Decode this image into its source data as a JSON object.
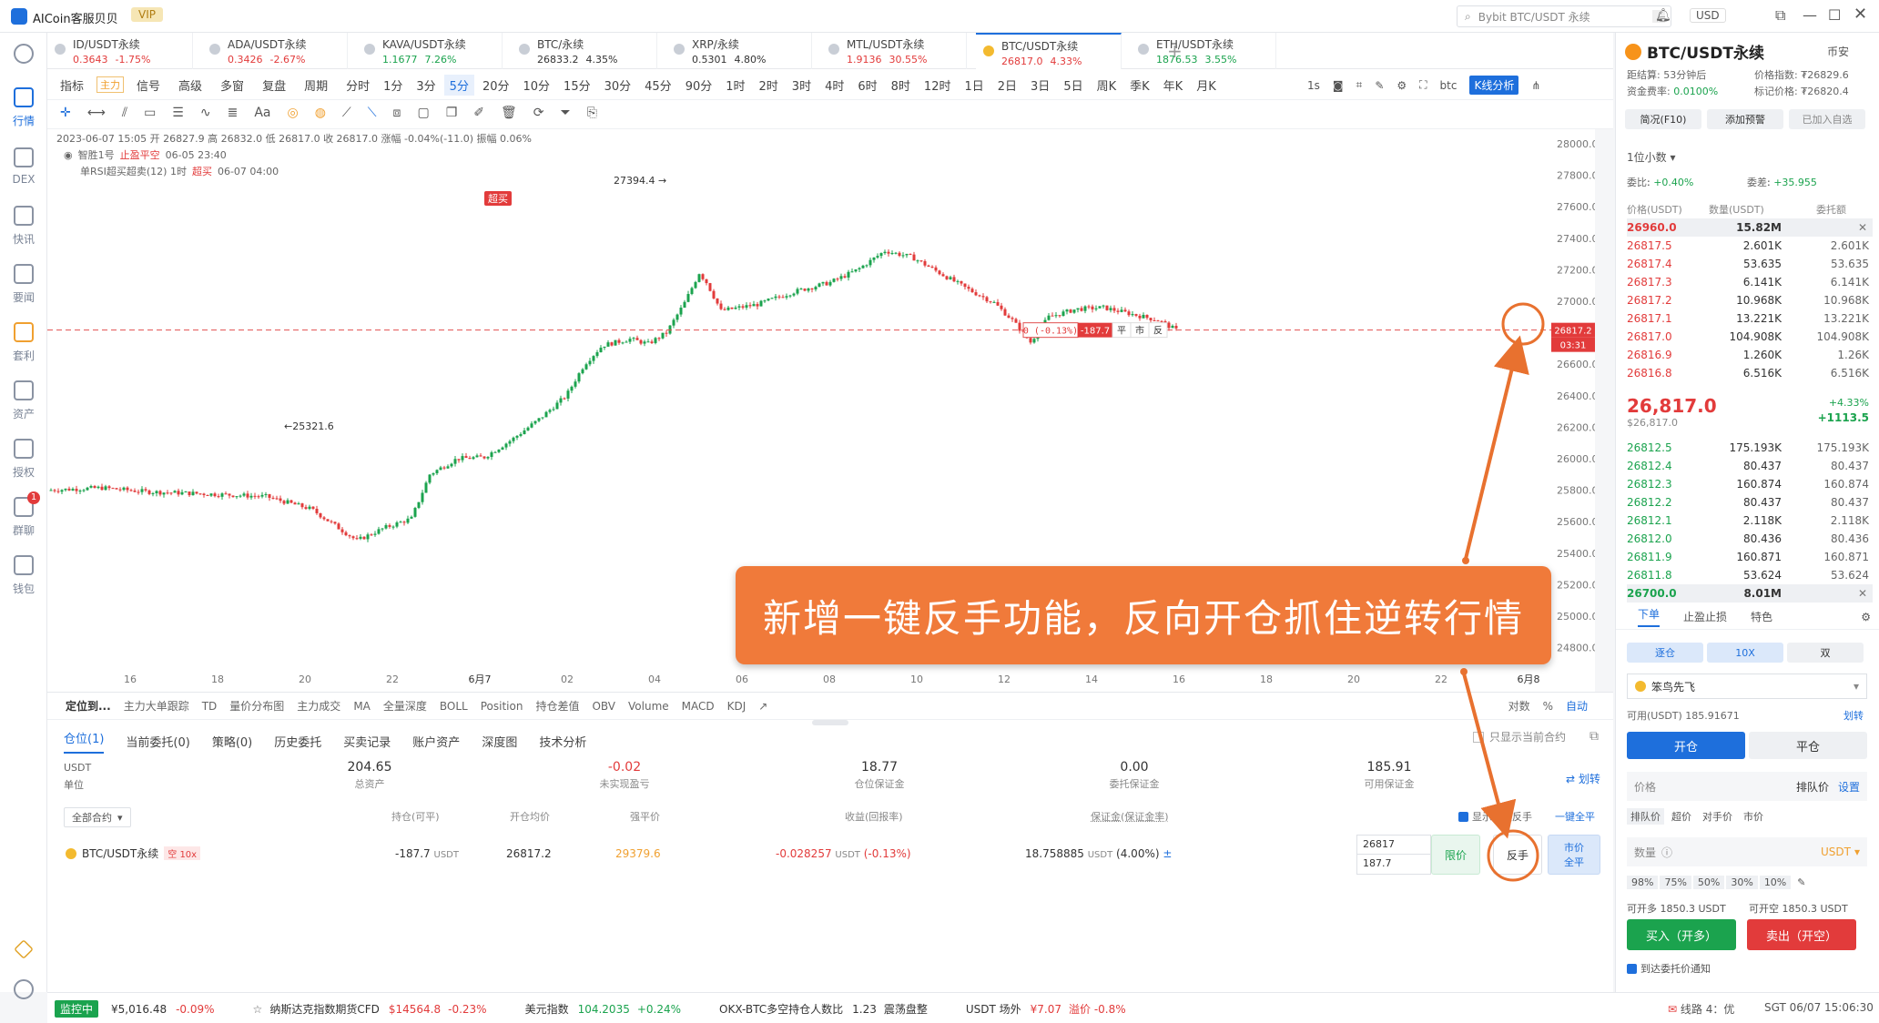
{
  "app": {
    "name": "AICoin客服贝贝",
    "vip": "VIP",
    "search_placeholder": "Bybit BTC/USDT 永续",
    "search_shortcut": "/",
    "currency": "USD"
  },
  "rail": [
    {
      "label": "",
      "icon": "globe-icon"
    },
    {
      "label": "行情",
      "icon": "market-icon"
    },
    {
      "label": "DEX",
      "icon": "dex-icon"
    },
    {
      "label": "快讯",
      "icon": "news-icon"
    },
    {
      "label": "要闻",
      "icon": "headline-icon"
    },
    {
      "label": "套利",
      "icon": "arbitrage-icon"
    },
    {
      "label": "资产",
      "icon": "wallet-icon"
    },
    {
      "label": "授权",
      "icon": "key-icon"
    },
    {
      "label": "群聊",
      "icon": "chat-icon",
      "badge": "1"
    },
    {
      "label": "钱包",
      "icon": "purse-icon"
    }
  ],
  "tabs": [
    {
      "name": "ID/USDT永续",
      "price": "0.3643",
      "change": "-1.75%",
      "dir": "dn"
    },
    {
      "name": "ADA/USDT永续",
      "price": "0.3426",
      "change": "-2.67%",
      "dir": "dn"
    },
    {
      "name": "KAVA/USDT永续",
      "price": "1.1677",
      "change": "7.26%",
      "dir": "up"
    },
    {
      "name": "BTC/永续",
      "price": "26833.2",
      "change": "4.35%",
      "dir": "plain"
    },
    {
      "name": "XRP/永续",
      "price": "0.5301",
      "change": "4.80%",
      "dir": "plain"
    },
    {
      "name": "MTL/USDT永续",
      "price": "1.9136",
      "change": "30.55%",
      "dir": "dn"
    },
    {
      "name": "BTC/USDT永续",
      "price": "26817.0",
      "change": "4.33%",
      "dir": "dn"
    },
    {
      "name": "ETH/USDT永续",
      "price": "1876.53",
      "change": "3.55%",
      "dir": "up"
    }
  ],
  "toolbar1": {
    "items": [
      "指标",
      "主力",
      "信号",
      "高级",
      "多窗",
      "复盘",
      "周期",
      "分时",
      "1分",
      "3分",
      "5分",
      "20分",
      "10分",
      "15分",
      "30分",
      "45分",
      "90分",
      "1时",
      "2时",
      "3时",
      "4时",
      "6时",
      "8时",
      "12时",
      "1日",
      "2日",
      "3日",
      "5日",
      "周K",
      "季K",
      "年K",
      "月K"
    ],
    "right": [
      "1s",
      "btc",
      "K线分析"
    ]
  },
  "ohlc": "2023-06-07 15:05  开 26827.9  高 26832.0  低 26817.0  收 26817.0  涨幅 -0.04%(-11.0)  振幅 0.06%",
  "strategy": {
    "line1": "智胜1号",
    "line1_tag": "止盈平空",
    "line1_time": "06-05 23:40",
    "line2": "单RSI超买超卖(12) 1时",
    "line2_tag": "超买",
    "line2_time": "06-07 04:00"
  },
  "chart_data": {
    "type": "candlestick",
    "y_ticks": [
      "28000.0",
      "27800.0",
      "27600.0",
      "27400.0",
      "27200.0",
      "27000.0",
      "26800.0",
      "26600.0",
      "26400.0",
      "26200.0",
      "26000.0",
      "25800.0",
      "25600.0",
      "25400.0",
      "25200.0",
      "25000.0",
      "24800.0"
    ],
    "x_ticks": [
      "16",
      "18",
      "20",
      "22",
      "6月7",
      "02",
      "04",
      "06",
      "08",
      "10",
      "12",
      "14",
      "16",
      "18",
      "20",
      "22",
      "6月8"
    ],
    "high_label": "27394.4",
    "low_label": "25321.6",
    "signal": "超买",
    "position_line": {
      "pnl": "0 (-0.13%)",
      "qty": "-187.7",
      "b1": "平",
      "b2": "市",
      "b3": "反"
    },
    "last_price": "26817.2",
    "countdown": "03:31"
  },
  "callout": "新增一键反手功能，反向开仓抓住逆转行情",
  "indicator_bar": {
    "left": [
      "定位到...",
      "主力大单跟踪",
      "TD",
      "量价分布图",
      "主力成交",
      "MA",
      "全量深度",
      "BOLL",
      "Position",
      "持仓差值",
      "OBV",
      "Volume",
      "MACD",
      "KDJ"
    ],
    "right": [
      "对数",
      "%",
      "自动"
    ]
  },
  "bottom_tabs": [
    "仓位(1)",
    "当前委托(0)",
    "策略(0)",
    "历史委托",
    "买卖记录",
    "账户资产",
    "深度图",
    "技术分析"
  ],
  "only_current": "只显示当前合约",
  "summary": {
    "unit": "USDT",
    "unit_label": "单位",
    "total": "204.65",
    "total_label": "总资产",
    "unreal": "-0.02",
    "unreal_label": "未实现盈亏",
    "margin": "18.77",
    "margin_label": "仓位保证金",
    "order_margin": "0.00",
    "order_margin_label": "委托保证金",
    "avail": "185.91",
    "avail_label": "可用保证金",
    "switch": "⇄ 划转"
  },
  "pos_header": {
    "filter": "全部合约",
    "cols": [
      "持仓(可平)",
      "开仓均价",
      "强平价",
      "收益(回报率)",
      "保证金(保证金率)"
    ],
    "show_reverse": "显示一键反手",
    "close_all": "一键全平"
  },
  "position": {
    "name": "BTC/USDT永续",
    "tag": "空 10x",
    "qty": "-187.7",
    "qty_unit": "USDT",
    "entry": "26817.2",
    "liq": "29379.6",
    "pnl": "-0.028257",
    "pnl_unit": "USDT",
    "pnl_pct": "(-0.13%)",
    "margin": "18.758885",
    "margin_unit": "USDT",
    "margin_pct": "(4.00%)",
    "price_input": "26817",
    "qty_input": "187.7",
    "limit_btn": "限价",
    "reverse_btn": "反手",
    "market_btn1": "市价",
    "market_btn2": "全平"
  },
  "statusbar": {
    "monitor": "监控中",
    "items": [
      {
        "label": "¥5,016.48",
        "val": "-0.09%",
        "dir": "dn"
      },
      {
        "label": "纳斯达克指数期货CFD",
        "val": "$14564.8",
        "extra": "-0.23%",
        "dir": "dn"
      },
      {
        "label": "美元指数",
        "val": "104.2035",
        "extra": "+0.24%",
        "dir": "up"
      },
      {
        "label": "OKX-BTC多空持仓人数比",
        "val": "1.23",
        "extra": "震荡盘整",
        "dir": "plain"
      },
      {
        "label": "USDT 场外",
        "val": "¥7.07",
        "extra": "溢价 -0.8%",
        "dir": "dn"
      }
    ],
    "line": "线路 4：优",
    "time": "SGT  06/07 15:06:30"
  },
  "right": {
    "title": "BTC/USDT永续",
    "sub": "币安",
    "funding_label": "距结算",
    "funding": "53分钟后",
    "index_label": "价格指数",
    "index": "₮26829.6",
    "rate_label": "资金费率",
    "rate": "0.0100%",
    "mark_label": "标记价格",
    "mark": "₮26820.4",
    "btn1": "简况(F10)",
    "btn2": "添加预警",
    "btn3": "已加入自选",
    "decimals": "1位小数",
    "wb_label": "委比",
    "wb": "+0.40%",
    "wc_label": "委差",
    "wc": "+35.955",
    "cols": [
      "价格(USDT)",
      "数量(USDT)",
      "委托额"
    ],
    "asks": [
      {
        "p": "26960.0",
        "q": "15.82M",
        "a": ""
      },
      {
        "p": "26817.5",
        "q": "2.601K",
        "a": "2.601K"
      },
      {
        "p": "26817.4",
        "q": "53.635",
        "a": "53.635"
      },
      {
        "p": "26817.3",
        "q": "6.141K",
        "a": "6.141K"
      },
      {
        "p": "26817.2",
        "q": "10.968K",
        "a": "10.968K"
      },
      {
        "p": "26817.1",
        "q": "13.221K",
        "a": "13.221K"
      },
      {
        "p": "26817.0",
        "q": "104.908K",
        "a": "104.908K"
      },
      {
        "p": "26816.9",
        "q": "1.260K",
        "a": "1.26K"
      },
      {
        "p": "26816.8",
        "q": "6.516K",
        "a": "6.516K"
      }
    ],
    "last": "26,817.0",
    "last_sub": "$26,817.0",
    "last_pct": "+4.33%",
    "last_chg": "+1113.5",
    "bids": [
      {
        "p": "26812.5",
        "q": "175.193K",
        "a": "175.193K"
      },
      {
        "p": "26812.4",
        "q": "80.437",
        "a": "80.437"
      },
      {
        "p": "26812.3",
        "q": "160.874",
        "a": "160.874"
      },
      {
        "p": "26812.2",
        "q": "80.437",
        "a": "80.437"
      },
      {
        "p": "26812.1",
        "q": "2.118K",
        "a": "2.118K"
      },
      {
        "p": "26812.0",
        "q": "80.436",
        "a": "80.436"
      },
      {
        "p": "26811.9",
        "q": "160.871",
        "a": "160.871"
      },
      {
        "p": "26811.8",
        "q": "53.624",
        "a": "53.624"
      },
      {
        "p": "26700.0",
        "q": "8.01M",
        "a": ""
      }
    ],
    "order_tabs": [
      "下单",
      "止盈止损",
      "特色"
    ],
    "modes": [
      "逐仓",
      "10X",
      "双"
    ],
    "account": "笨鸟先飞",
    "avail": "可用(USDT) 185.91671",
    "transfer": "划转",
    "open": "开仓",
    "close": "平仓",
    "price_label": "价格",
    "price_mode": "排队价",
    "price_set": "设置",
    "price_types": [
      "排队价",
      "超价",
      "对手价",
      "市价"
    ],
    "qty_label": "数量",
    "qty_unit": "USDT",
    "pcts": [
      "98%",
      "75%",
      "50%",
      "30%",
      "10%"
    ],
    "can_open_l": "可开多 1850.3 USDT",
    "can_open_s": "可开空 1850.3 USDT",
    "buy": "买入（开多）",
    "sell": "卖出（开空）",
    "notify": "到达委托价通知"
  }
}
